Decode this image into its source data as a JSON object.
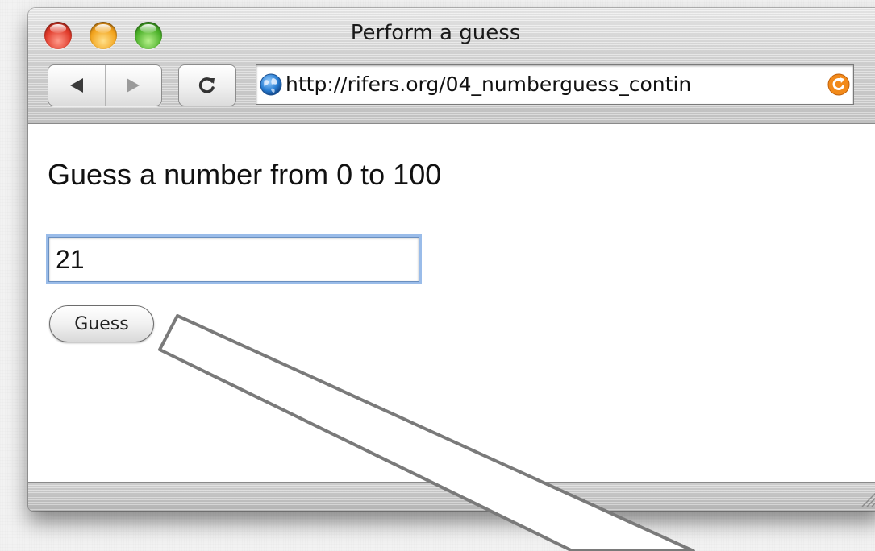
{
  "window": {
    "title": "Perform a guess"
  },
  "toolbar": {
    "back_icon": "back-arrow-icon",
    "forward_icon": "forward-arrow-icon",
    "reload_icon": "reload-icon",
    "url": "http://rifers.org/04_numberguess_contin"
  },
  "page": {
    "prompt": "Guess a number from 0 to 100",
    "guess_input_value": "21",
    "guess_button_label": "Guess"
  },
  "colors": {
    "focus_ring": "#78a5e1",
    "globe_blue": "#2a7fd4",
    "url_action_orange": "#f28a1a"
  }
}
